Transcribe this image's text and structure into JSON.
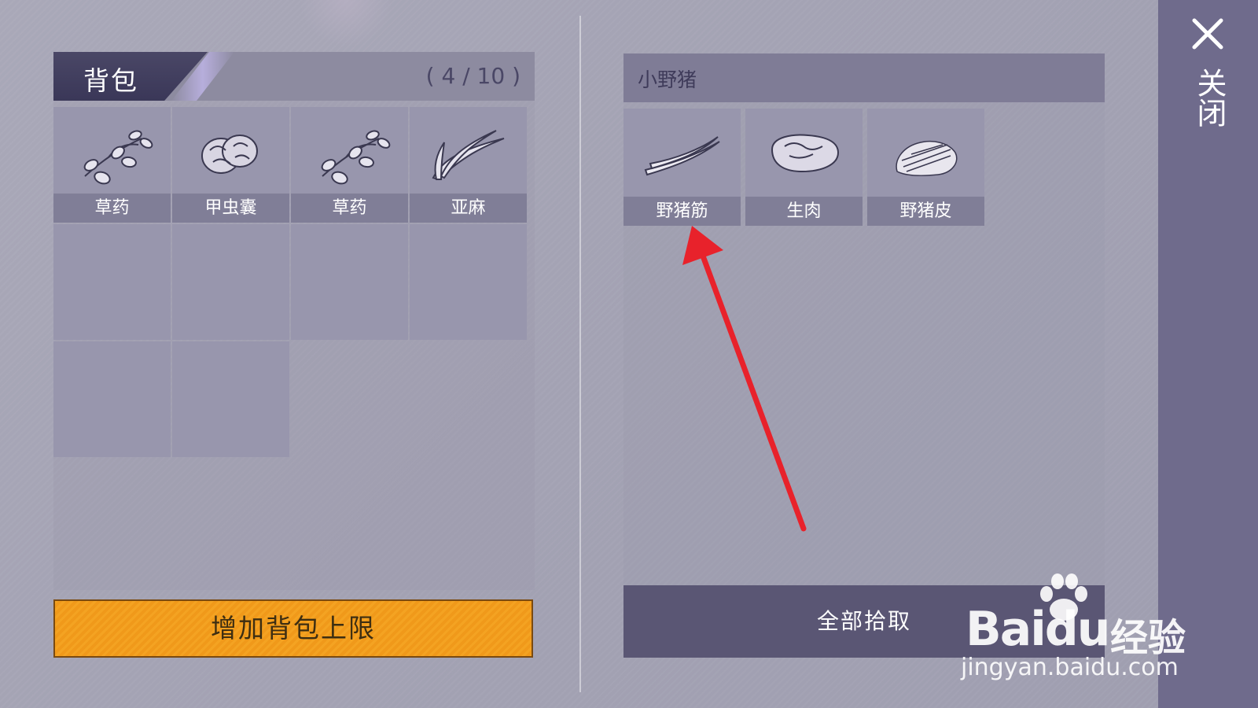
{
  "bag": {
    "title": "背包",
    "count": "( 4 / 10 )",
    "items": [
      {
        "label": "草药",
        "icon": "herb-icon"
      },
      {
        "label": "甲虫囊",
        "icon": "beetle-sac-icon"
      },
      {
        "label": "草药",
        "icon": "herb-icon"
      },
      {
        "label": "亚麻",
        "icon": "flax-icon"
      }
    ],
    "expand_label": "增加背包上限"
  },
  "loot": {
    "source_name": "小野猪",
    "items": [
      {
        "label": "野猪筋",
        "icon": "boar-tendon-icon"
      },
      {
        "label": "生肉",
        "icon": "raw-meat-icon"
      },
      {
        "label": "野猪皮",
        "icon": "boar-hide-icon"
      }
    ],
    "pickup_all_label": "全部拾取"
  },
  "close": {
    "label": "关闭"
  },
  "watermark": {
    "brand": "Bai",
    "brand_du": "du",
    "cn": "经验",
    "url": "jingyan.baidu.com"
  },
  "colors": {
    "accent_orange": "#f4a322",
    "panel_dark": "#5a5674",
    "close_bar": "#6f6b8c",
    "arrow_red": "#e8222b"
  }
}
